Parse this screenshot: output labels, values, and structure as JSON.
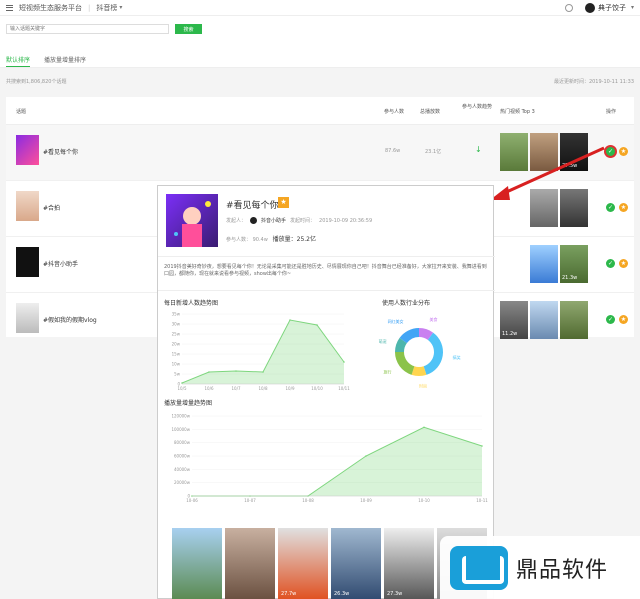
{
  "topbar": {
    "title": "短视频生态服务平台",
    "app": "抖音榜",
    "user": "典子饺子"
  },
  "search": {
    "placeholder": "输入话题关键字",
    "button": "搜索"
  },
  "tabs": [
    {
      "label": "默认排序",
      "active": true
    },
    {
      "label": "播放量增量排序",
      "active": false
    }
  ],
  "stats": {
    "total": "共搜索到1,806,820个话题",
    "updated": "最近更新时间：2019-10-11 11:33"
  },
  "table": {
    "headers": {
      "topic": "话题",
      "users": "参与人数",
      "plays": "总播放数",
      "trend": "参与人数趋势",
      "hot": "热门视频 Top 3",
      "op": "操作"
    },
    "rows": [
      {
        "name": "#看见每个你",
        "users": "87.6w",
        "plays": "23.1亿",
        "hot_counts": [
          "",
          "",
          "27.5w"
        ]
      },
      {
        "name": "#合拍",
        "users": "",
        "plays": "",
        "hot_counts": [
          "",
          "",
          ""
        ]
      },
      {
        "name": "#抖音小助手",
        "users": "",
        "plays": "",
        "hot_counts": [
          "",
          "",
          "21.3w"
        ]
      },
      {
        "name": "#假如我的假期vlog",
        "users": "",
        "plays": "",
        "hot_counts": [
          "11.2w",
          "",
          ""
        ]
      }
    ]
  },
  "panel": {
    "title": "#看见每个你",
    "creator_label": "发起人：",
    "creator": "抖音小助手",
    "created_label": "发起时间：",
    "created": "2019-10-09 20:36:59",
    "users_label": "参与人数：",
    "users": "90.4w",
    "plays_label": "播放量：",
    "plays": "25.2亿",
    "description": "2019抖音美好奇妙夜，想要看见每个你！无论是采集可能还是胜地历史、尽情展现你自己吧！抖音舞台已经准备好，大家拉开来安装、我舞进看到口园，都随你，现在就来说看参与视频，show出每个你~",
    "daily_title": "每日新增人数趋势图",
    "industry_title": "使用人数行业分布",
    "plays_title": "播放量增量趋势图",
    "video_counts": [
      "",
      "",
      "27.7w",
      "26.3w",
      "27.3w",
      ""
    ]
  },
  "chart_data": [
    {
      "type": "area",
      "title": "每日新增人数趋势图",
      "categories": [
        "10/5",
        "10/6",
        "10/7",
        "10/8",
        "10/9",
        "10/10",
        "10/11"
      ],
      "values": [
        0.5,
        6,
        6.5,
        6,
        32,
        29.5,
        11
      ],
      "ytick_labels": [
        "0",
        "5w",
        "10w",
        "15w",
        "20w",
        "25w",
        "30w",
        "35w"
      ],
      "ylim": [
        0,
        35
      ],
      "color": "#7ed67e"
    },
    {
      "type": "pie",
      "title": "使用人数行业分布",
      "labels": [
        "美食",
        "搞笑",
        "时尚",
        "旅行",
        "萌宠",
        "网红美女"
      ],
      "values": [
        10,
        35,
        10,
        20,
        10,
        15
      ],
      "colors": [
        "#c980f0",
        "#4fc3f7",
        "#ffd54f",
        "#8bc34a",
        "#4db6ac",
        "#42a5f5"
      ]
    },
    {
      "type": "area",
      "title": "播放量增量趋势图",
      "categories": [
        "10-06",
        "10-07",
        "10-08",
        "10-09",
        "10-10",
        "10-11"
      ],
      "values": [
        0,
        0,
        0,
        60000,
        103000,
        75000
      ],
      "ytick_labels": [
        "0",
        "20000w",
        "40000w",
        "60000w",
        "80000w",
        "100000w",
        "120000w"
      ],
      "ylim": [
        0,
        120000
      ],
      "color": "#7ed67e"
    }
  ],
  "watermark": "鼎品软件"
}
